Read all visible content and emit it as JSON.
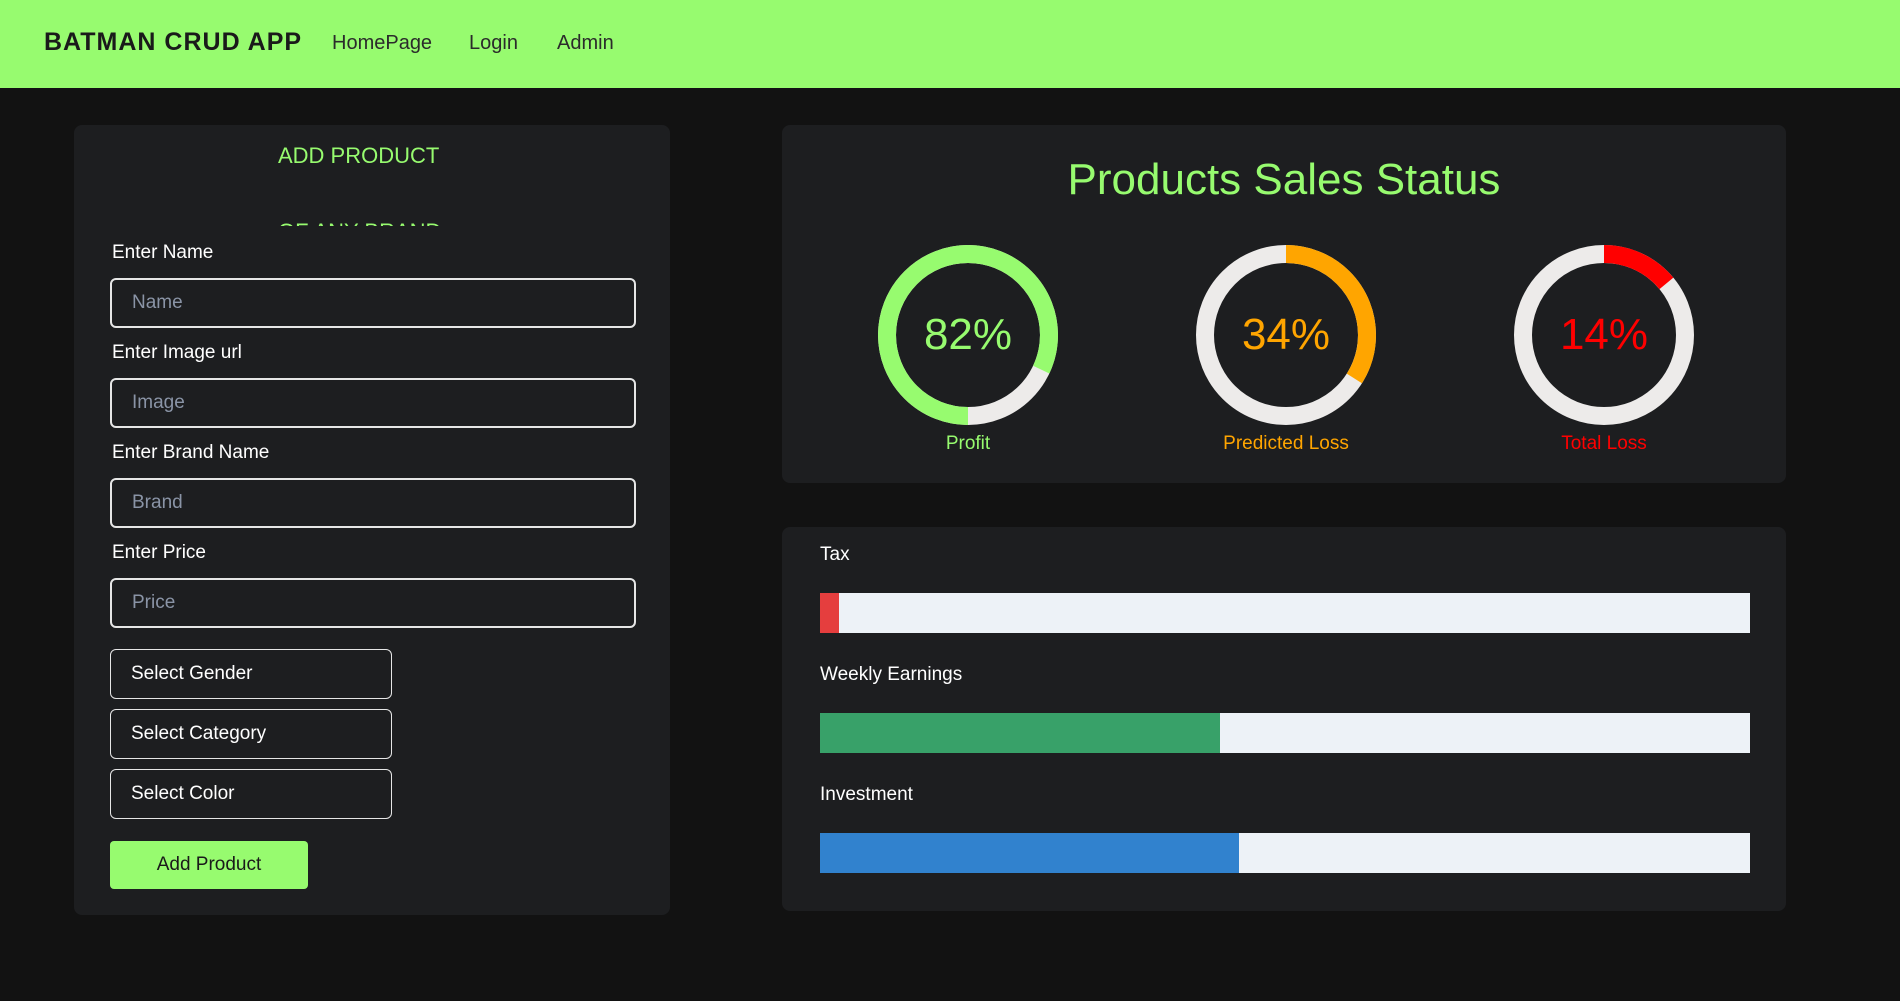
{
  "navbar": {
    "brand": "BATMAN CRUD APP",
    "links": [
      "HomePage",
      "Login",
      "Admin"
    ]
  },
  "form": {
    "title_line1": "ADD PRODUCT",
    "title_line2": "OF ANY BRAND",
    "fields": [
      {
        "label": "Enter Name",
        "placeholder": "Name"
      },
      {
        "label": "Enter Image url",
        "placeholder": "Image"
      },
      {
        "label": "Enter Brand Name",
        "placeholder": "Brand"
      },
      {
        "label": "Enter Price",
        "placeholder": "Price"
      }
    ],
    "selects": [
      "Select Gender",
      "Select Category",
      "Select Color"
    ],
    "submit_label": "Add Product"
  },
  "status": {
    "title": "Products Sales Status",
    "gauges": [
      {
        "value_text": "82%",
        "value": 0.82,
        "label": "Profit",
        "color": "#97fb6f",
        "start": 0.5
      },
      {
        "value_text": "34%",
        "value": 0.34,
        "label": "Predicted Loss",
        "color": "#ffa500",
        "start": 0.0
      },
      {
        "value_text": "14%",
        "value": 0.14,
        "label": "Total Loss",
        "color": "#ff0000",
        "start": 0.0
      }
    ],
    "track_color": "#edebea"
  },
  "bars": [
    {
      "label": "Tax",
      "value": 0.02,
      "color": "#e53e3e"
    },
    {
      "label": "Weekly Earnings",
      "value": 0.43,
      "color": "#38a169"
    },
    {
      "label": "Investment",
      "value": 0.45,
      "color": "#3182ce"
    }
  ]
}
